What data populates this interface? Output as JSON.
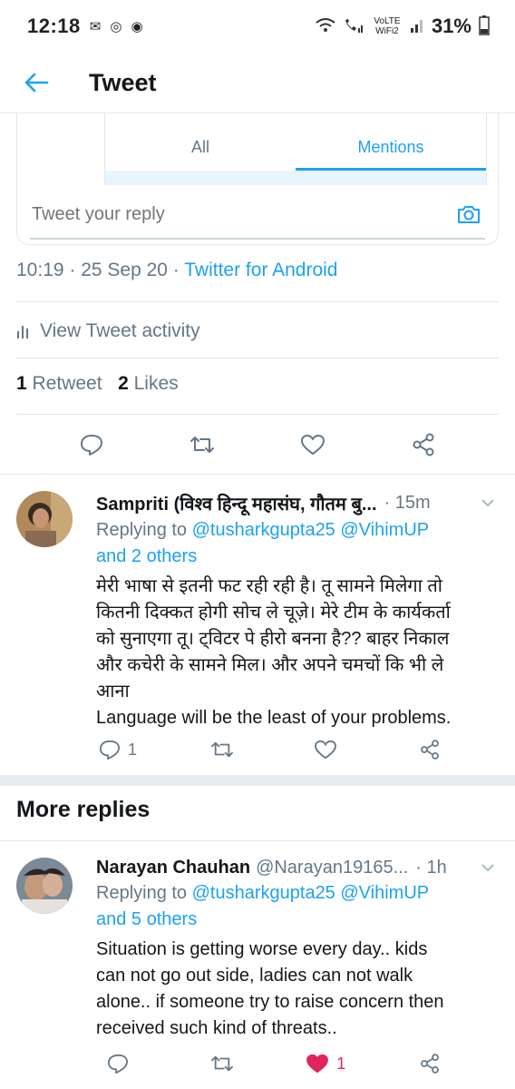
{
  "status_bar": {
    "time": "12:18",
    "carrier_labels": "VoLTE WiFi2",
    "battery": "31%"
  },
  "header": {
    "title": "Tweet"
  },
  "embed": {
    "tabs": [
      {
        "label": "All",
        "active": false
      },
      {
        "label": "Mentions",
        "active": true
      }
    ],
    "reply_placeholder": "Tweet your reply"
  },
  "tweet_meta": {
    "timestamp": "10:19 · 25 Sep 20 · ",
    "source": "Twitter for Android"
  },
  "activity_label": "View Tweet activity",
  "stats": {
    "retweets": "1",
    "retweets_label": "Retweet",
    "likes": "2",
    "likes_label": "Likes"
  },
  "replies": [
    {
      "name": "Sampriti (विश्व हिन्दू महासंघ, गौतम बु...",
      "handle": "",
      "time": "· 15m",
      "replying_prefix": "Replying to",
      "replying_users": "@tusharkgupta25 @VihimUP",
      "replying_others": "and 2 others",
      "text_lines": [
        "मेरी भाषा से इतनी फट रही रही है। तू सामने मिलेगा तो",
        "कितनी दिक्कत होगी सोच ले चूज़े। मेरे टीम के कार्यकर्ता",
        "को सुनाएगा तू। ट्विटर पे हीरो बनना है?? बाहर निकाल",
        "और कचेरी के सामने मिल। और अपने चमचों कि भी ले",
        "आना",
        "Language will be the least of your problems."
      ],
      "reply_count": "1",
      "retweet_count": "",
      "like_count": "",
      "liked": false
    },
    {
      "name": "Narayan Chauhan",
      "handle": "@Narayan19165...",
      "time": "· 1h",
      "replying_prefix": "Replying to",
      "replying_users": "@tusharkgupta25 @VihimUP",
      "replying_others": "and 5 others",
      "text_lines": [
        "Situation is getting worse every day.. kids",
        "can not go out side, ladies can not walk",
        "alone.. if someone try to raise concern then",
        "received such kind of threats.."
      ],
      "reply_count": "",
      "retweet_count": "",
      "like_count": "1",
      "liked": true
    }
  ],
  "more_replies_title": "More replies",
  "colors": {
    "accent": "#1da1f2",
    "muted": "#657786",
    "like": "#e0245e",
    "divider": "#e1e8ed"
  }
}
